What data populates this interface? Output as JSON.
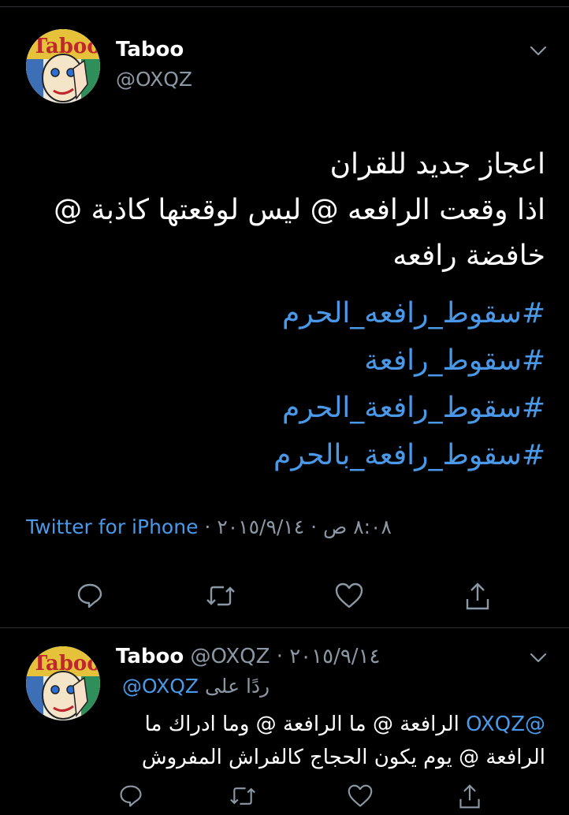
{
  "tweet": {
    "author_name": "Taboo",
    "author_handle": "@OXQZ",
    "text_lines": [
      "اعجاز جديد للقران",
      "اذا وقعت الرافعه @ ليس لوقعتها كاذبة @",
      "خافضة رافعه"
    ],
    "hashtags": [
      "#سقوط_رافعه_الحرم",
      "#سقوط_رافعة",
      "#سقوط_رافعة_الحرم",
      "#سقوط_رافعة_بالحرم"
    ],
    "source": "Twitter for iPhone",
    "separator": "·",
    "date": "٢٠١٥/٩/١٤",
    "time": "٨:٠٨ ص"
  },
  "reply": {
    "author_name": "Taboo",
    "author_handle": "@OXQZ",
    "separator": "·",
    "date": "٢٠١٥/٩/١٤",
    "replying_label": "ردًا على",
    "replying_to": "@OXQZ",
    "mention": "@OXQZ",
    "text_line1": " الرافعة @ ما الرافعة @ وما ادراك ما",
    "text_line2": "الرافعة @ يوم يكون الحجاج كالفراش المفروش"
  },
  "icons": {
    "avatar_logo": "Taboo",
    "action_icons": [
      "reply-icon",
      "retweet-icon",
      "like-icon",
      "share-icon"
    ],
    "menu_icon": "chevron-down-icon"
  },
  "colors": {
    "background": "#000000",
    "link": "#4a99e9",
    "muted": "#8b98a5",
    "divider": "#2f3336"
  }
}
